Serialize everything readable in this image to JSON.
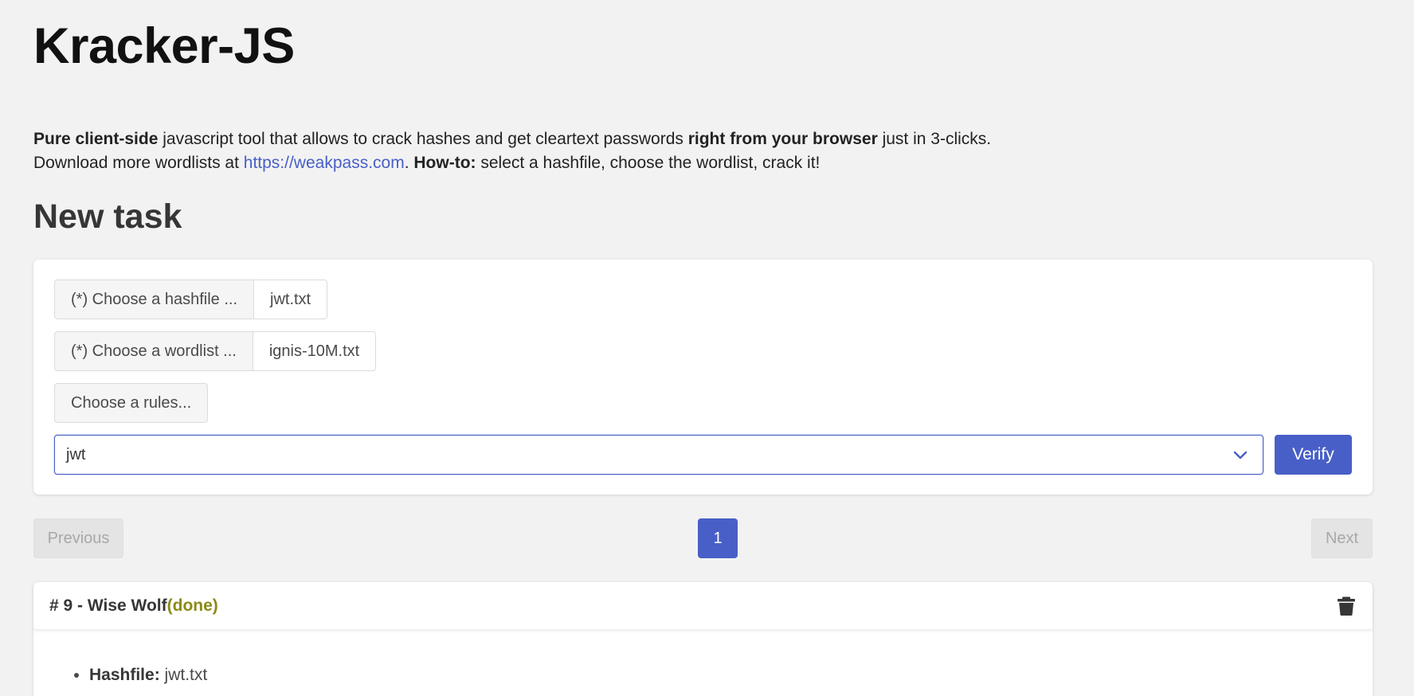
{
  "header": {
    "title": "Kracker-JS"
  },
  "intro": {
    "line1_bold1": "Pure client-side",
    "line1_text1": " javascript tool that allows to crack hashes and get cleartext passwords ",
    "line1_bold2": "right from your browser",
    "line1_text2": " just in 3-clicks.",
    "line2_text1": "Download more wordlists at ",
    "line2_link": "https://weakpass.com",
    "line2_text2": ". ",
    "line2_bold": "How-to:",
    "line2_text3": " select a hashfile, choose the wordlist, crack it!"
  },
  "new_task": {
    "title": "New task",
    "hashfile": {
      "button_label": "(*) Choose a hashfile ...",
      "file_name": "jwt.txt"
    },
    "wordlist": {
      "button_label": "(*) Choose a wordlist ...",
      "file_name": "ignis-10M.txt"
    },
    "rules": {
      "button_label": "Choose a rules..."
    },
    "hash_type": {
      "selected": "jwt"
    },
    "verify_label": "Verify"
  },
  "pagination": {
    "previous_label": "Previous",
    "current_page": "1",
    "next_label": "Next"
  },
  "tasks": [
    {
      "title": "# 9 - Wise Wolf",
      "status": "(done)",
      "hashfile_label": "Hashfile:",
      "hashfile_value": " jwt.txt"
    }
  ],
  "colors": {
    "accent": "#485fc7",
    "background": "#f2f2f2",
    "status_done": "#8b8a16"
  }
}
